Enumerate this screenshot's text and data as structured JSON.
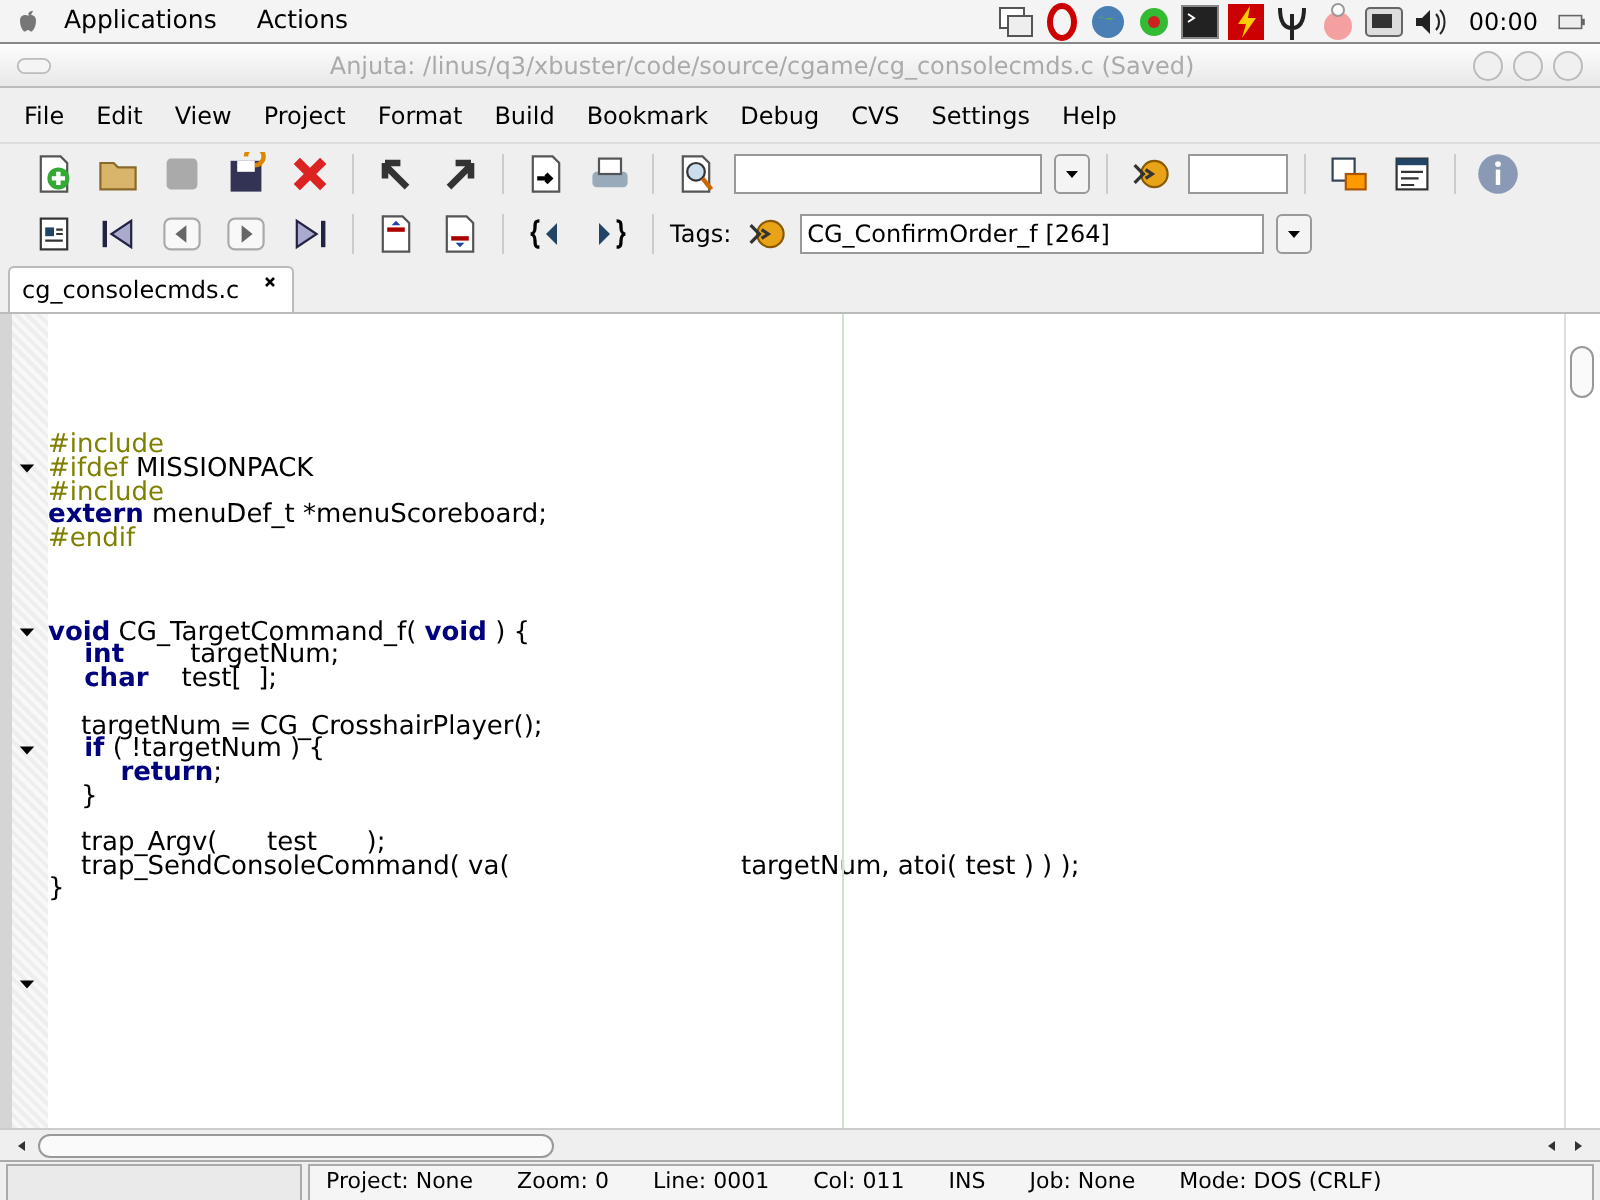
{
  "top_panel": {
    "menus": [
      "Applications",
      "Actions"
    ],
    "clock": "00:00"
  },
  "window": {
    "title": "Anjuta: /linus/q3/xbuster/code/source/cgame/cg_consolecmds.c (Saved)"
  },
  "menu_bar": [
    "File",
    "Edit",
    "View",
    "Project",
    "Format",
    "Build",
    "Bookmark",
    "Debug",
    "CVS",
    "Settings",
    "Help"
  ],
  "toolbar": {
    "tags_label": "Tags:",
    "tags_value": "CG_ConfirmOrder_f [264]"
  },
  "tabs": [
    {
      "label": "cg_consolecmds.c",
      "selected": true
    }
  ],
  "code_lines": [
    {
      "kind": "blank"
    },
    {
      "kind": "blank"
    },
    {
      "kind": "blank"
    },
    {
      "kind": "blank"
    },
    {
      "kind": "blank"
    },
    {
      "kind": "code",
      "fold": false,
      "segments": [
        {
          "text": "#include",
          "kind": "preproc"
        }
      ]
    },
    {
      "kind": "code",
      "fold": true,
      "segments": [
        {
          "text": "#ifdef",
          "kind": "preproc"
        },
        {
          "text": " MISSIONPACK",
          "kind": "plain"
        }
      ]
    },
    {
      "kind": "code",
      "fold": false,
      "segments": [
        {
          "text": "#include",
          "kind": "preproc"
        }
      ]
    },
    {
      "kind": "code",
      "fold": false,
      "segments": [
        {
          "text": "extern",
          "kind": "keyword"
        },
        {
          "text": " menuDef_t *menuScoreboard;",
          "kind": "plain"
        }
      ]
    },
    {
      "kind": "code",
      "fold": false,
      "segments": [
        {
          "text": "#endif",
          "kind": "preproc"
        }
      ]
    },
    {
      "kind": "blank"
    },
    {
      "kind": "blank"
    },
    {
      "kind": "blank"
    },
    {
      "kind": "code",
      "fold": true,
      "segments": [
        {
          "text": "void",
          "kind": "keyword"
        },
        {
          "text": " CG_TargetCommand_f( ",
          "kind": "plain"
        },
        {
          "text": "void",
          "kind": "keyword"
        },
        {
          "text": " ) {",
          "kind": "plain"
        }
      ]
    },
    {
      "kind": "code",
      "fold": false,
      "segments": [
        {
          "text": "    int",
          "kind": "keyword"
        },
        {
          "text": "        targetNum;",
          "kind": "plain"
        }
      ]
    },
    {
      "kind": "code",
      "fold": false,
      "segments": [
        {
          "text": "    char",
          "kind": "keyword"
        },
        {
          "text": "    test[  ];",
          "kind": "plain"
        }
      ]
    },
    {
      "kind": "blank"
    },
    {
      "kind": "code",
      "fold": false,
      "segments": [
        {
          "text": "    targetNum = CG_CrosshairPlayer();",
          "kind": "plain"
        }
      ]
    },
    {
      "kind": "code",
      "fold": true,
      "segments": [
        {
          "text": "    if",
          "kind": "keyword"
        },
        {
          "text": " ( !targetNum ) {",
          "kind": "plain"
        }
      ]
    },
    {
      "kind": "code",
      "fold": false,
      "segments": [
        {
          "text": "        return",
          "kind": "keyword"
        },
        {
          "text": ";",
          "kind": "plain"
        }
      ]
    },
    {
      "kind": "code",
      "fold": false,
      "segments": [
        {
          "text": "    }",
          "kind": "plain"
        }
      ]
    },
    {
      "kind": "blank"
    },
    {
      "kind": "code",
      "fold": false,
      "segments": [
        {
          "text": "    trap_Argv(      test      );",
          "kind": "plain"
        }
      ]
    },
    {
      "kind": "code",
      "fold": false,
      "segments": [
        {
          "text": "    trap_SendConsoleCommand( va(                            targetNum, atoi( test ) ) );",
          "kind": "plain"
        }
      ]
    },
    {
      "kind": "code",
      "fold": false,
      "segments": [
        {
          "text": "}",
          "kind": "plain"
        }
      ]
    },
    {
      "kind": "blank"
    },
    {
      "kind": "blank"
    },
    {
      "kind": "blank"
    },
    {
      "kind": "code",
      "fold": true
    }
  ],
  "status_bar": [
    "Project: None",
    "Zoom: 0",
    "Line: 0001",
    "Col: 011",
    "INS",
    "Job: None",
    "Mode: DOS (CRLF)"
  ]
}
